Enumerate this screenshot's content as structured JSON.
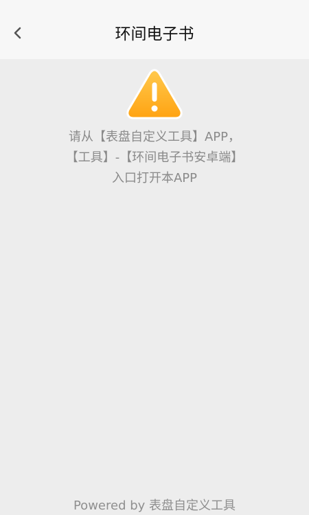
{
  "header": {
    "title": "环间电子书",
    "back_icon": "chevron-left-icon"
  },
  "notice": {
    "icon": "warning-icon",
    "icon_color": "#FFB32E",
    "lines": [
      "请从【表盘自定义工具】APP，",
      "【工具】-【环间电子书安卓端】",
      "入口打开本APP"
    ]
  },
  "footer": {
    "text": "Powered by 表盘自定义工具"
  }
}
